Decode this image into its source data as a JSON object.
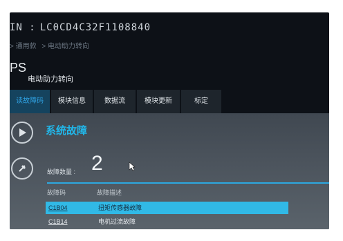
{
  "header": {
    "vin_label": "IN :",
    "vin_value": "LC0CD4C32F1108840"
  },
  "breadcrumb": [
    "> 通用款",
    "> 电动助力转向"
  ],
  "module": {
    "code": "PS",
    "name": "电动助力转向"
  },
  "tabs": [
    {
      "label": "读故障码",
      "active": true
    },
    {
      "label": "模块信息",
      "active": false
    },
    {
      "label": "数据流",
      "active": false
    },
    {
      "label": "模块更新",
      "active": false
    },
    {
      "label": "标定",
      "active": false
    }
  ],
  "fault_section": {
    "title": "系统故障",
    "count_label": "故障数量 :",
    "count_value": "2",
    "columns": {
      "code": "故障码",
      "desc": "故障描述"
    },
    "rows": [
      {
        "code": "C1B04",
        "desc": "扭矩传感器故障",
        "selected": true
      },
      {
        "code": "C1B14",
        "desc": "电机过流故障",
        "selected": false
      }
    ]
  },
  "colors": {
    "accent": "#2ca9e0",
    "tab_active": "#15435e",
    "selected_row": "#31b9e6",
    "screen_bg": "#0d1117"
  },
  "icons": [
    "play-icon",
    "eraser-icon",
    "mouse-cursor-icon"
  ]
}
